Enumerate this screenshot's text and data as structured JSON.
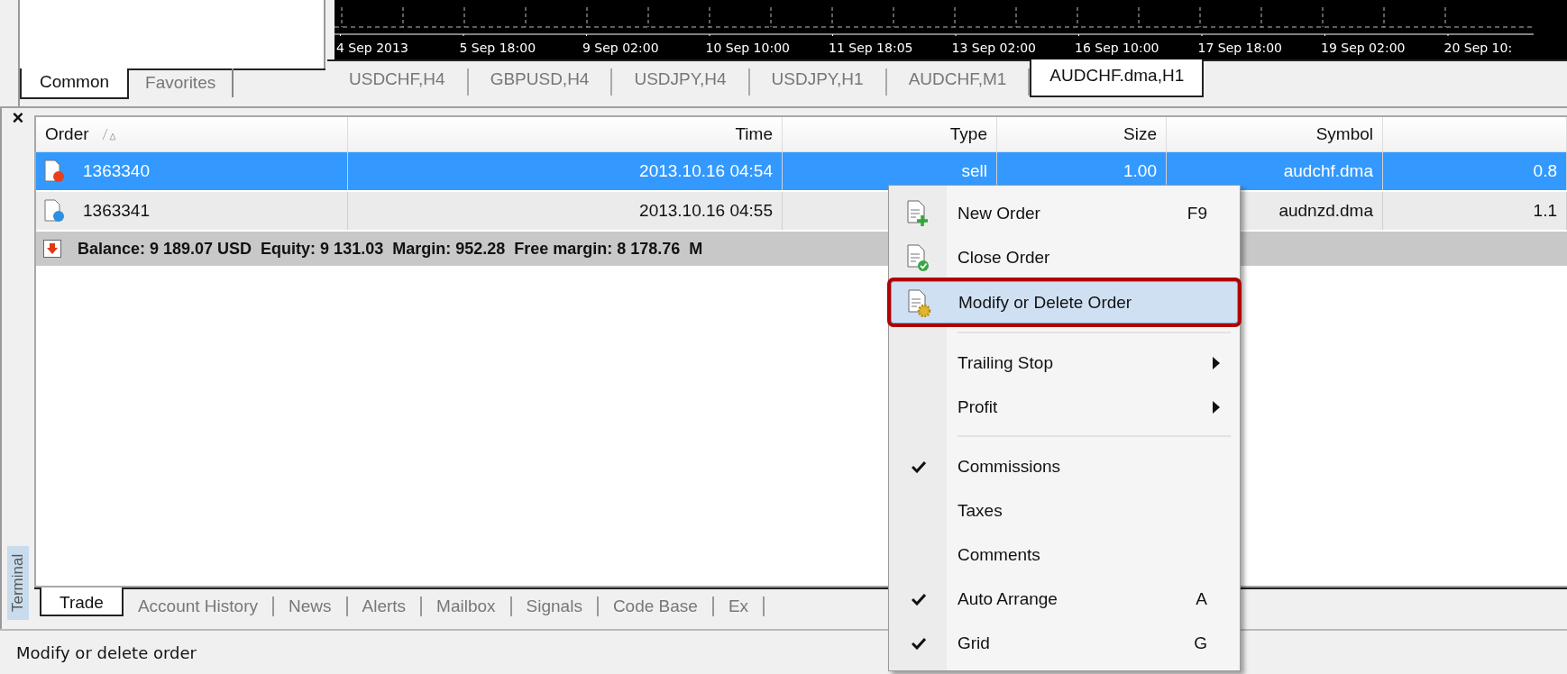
{
  "navigator": {
    "tabs": [
      {
        "label": "Common",
        "selected": true
      },
      {
        "label": "Favorites",
        "selected": false
      }
    ]
  },
  "chart": {
    "time_labels": [
      "4 Sep 2013",
      "5 Sep 18:00",
      "9 Sep 02:00",
      "10 Sep 10:00",
      "11 Sep 18:05",
      "13 Sep 02:00",
      "16 Sep 10:00",
      "17 Sep 18:00",
      "19 Sep 02:00",
      "20 Sep 10:"
    ]
  },
  "chart_tabs": [
    {
      "label": "USDCHF,H4",
      "selected": false
    },
    {
      "label": "GBPUSD,H4",
      "selected": false
    },
    {
      "label": "USDJPY,H4",
      "selected": false
    },
    {
      "label": "USDJPY,H1",
      "selected": false
    },
    {
      "label": "AUDCHF,M1",
      "selected": false
    },
    {
      "label": "AUDCHF.dma,H1",
      "selected": true
    }
  ],
  "terminal": {
    "close": "×",
    "title": "Terminal",
    "table": {
      "columns": [
        {
          "label": "Order",
          "sorted": true
        },
        {
          "label": "Time",
          "sorted": false
        },
        {
          "label": "Type",
          "sorted": false
        },
        {
          "label": "Size",
          "sorted": false
        },
        {
          "label": "Symbol",
          "sorted": false
        }
      ],
      "rows": [
        {
          "order": "1363340",
          "time": "2013.10.16 04:54",
          "type": "sell",
          "size": "1.00",
          "symbol": "audchf.dma",
          "column_6": "0.8",
          "color": "#e8401c",
          "selected": true
        },
        {
          "order": "1363341",
          "time": "2013.10.16 04:55",
          "symbol": "audnzd.dma",
          "column_6": "1.1",
          "color": "#2f8fe0",
          "selected": false
        }
      ],
      "balance": "Balance: 9 189.07 USD  Equity: 9 131.03  Margin: 952.28  Free margin: 8 178.76  M"
    },
    "tabs": [
      {
        "label": "Trade",
        "selected": true
      },
      {
        "label": "Account History",
        "selected": false
      },
      {
        "label": "News",
        "selected": false
      },
      {
        "label": "Alerts",
        "selected": false
      },
      {
        "label": "Mailbox",
        "selected": false
      },
      {
        "label": "Signals",
        "selected": false
      },
      {
        "label": "Code Base",
        "selected": false
      },
      {
        "label": "Ex",
        "selected": false
      }
    ]
  },
  "context_menu": {
    "items": [
      {
        "kind": "command",
        "label": "New Order",
        "shortcut": "F9",
        "selected": false
      },
      {
        "kind": "command",
        "label": "Close Order",
        "selected": false
      },
      {
        "kind": "command",
        "label": "Modify or Delete Order",
        "selected": true
      },
      {
        "kind": "separator"
      },
      {
        "kind": "submenu",
        "label": "Trailing Stop"
      },
      {
        "kind": "submenu",
        "label": "Profit"
      },
      {
        "kind": "separator"
      },
      {
        "kind": "toggle",
        "label": "Commissions",
        "checked": true
      },
      {
        "kind": "toggle",
        "label": "Taxes",
        "checked": false
      },
      {
        "kind": "toggle",
        "label": "Comments",
        "checked": false
      },
      {
        "kind": "toggle",
        "label": "Auto Arrange",
        "shortcut": "A",
        "checked": true
      },
      {
        "kind": "toggle",
        "label": "Grid",
        "shortcut": "G",
        "checked": true
      }
    ]
  },
  "status_bar": {
    "text": "Modify or delete order"
  }
}
